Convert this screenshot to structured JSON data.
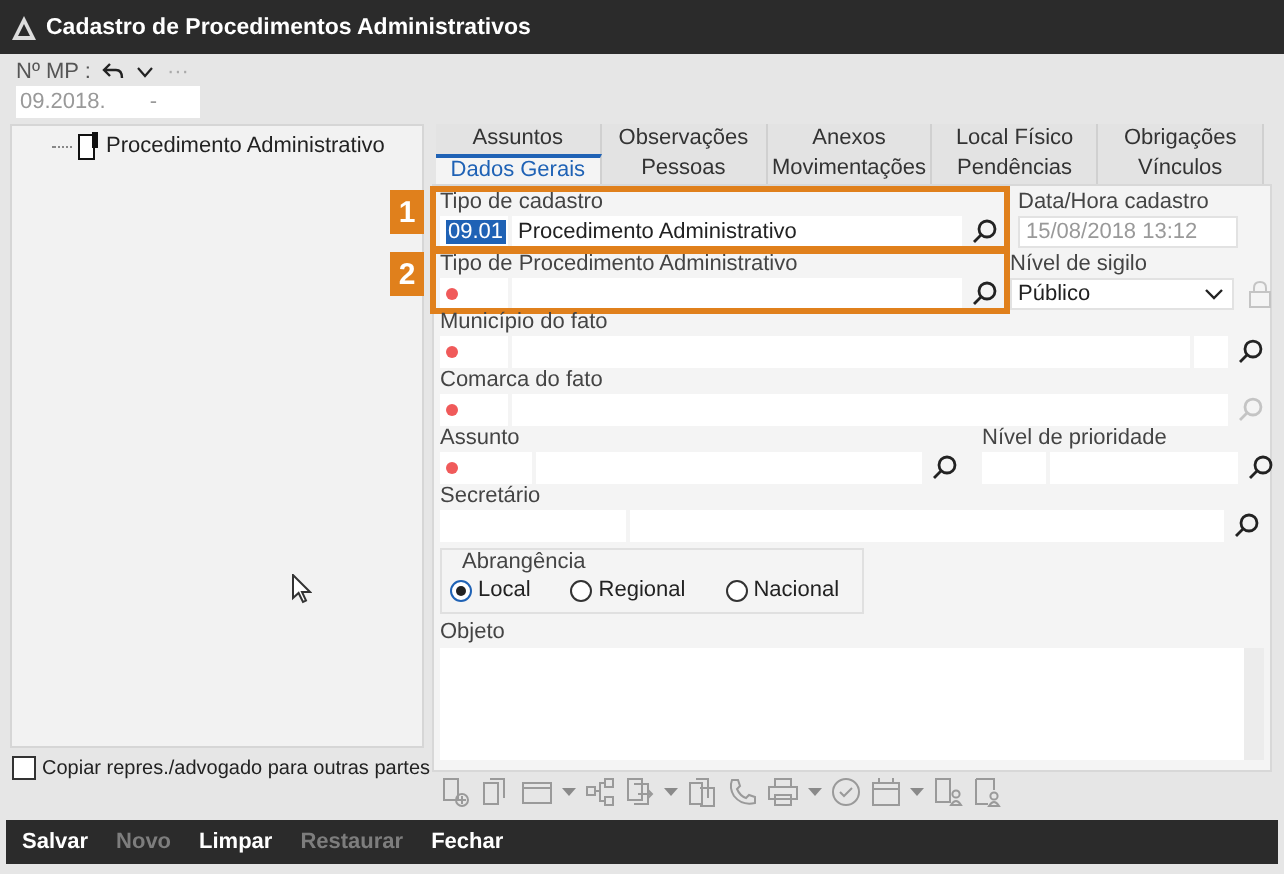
{
  "window": {
    "title": "Cadastro de Procedimentos Administrativos"
  },
  "mp": {
    "label": "Nº MP :",
    "value_parts": [
      "09.2018.",
      "-"
    ],
    "more": "···"
  },
  "tree": {
    "items": [
      {
        "label": "Procedimento Administrativo"
      }
    ]
  },
  "copy_checkbox": {
    "label": "Copiar repres./advogado para outras partes",
    "checked": false
  },
  "tab_rows": [
    [
      {
        "label": "Assuntos",
        "selected": false
      },
      {
        "label": "Observações",
        "selected": false
      },
      {
        "label": "Anexos",
        "selected": false
      },
      {
        "label": "Local Físico",
        "selected": false
      },
      {
        "label": "Obrigações",
        "selected": false
      }
    ],
    [
      {
        "label": "Dados Gerais",
        "selected": true
      },
      {
        "label": "Pessoas",
        "selected": false
      },
      {
        "label": "Movimentações",
        "selected": false
      },
      {
        "label": "Pendências",
        "selected": false
      },
      {
        "label": "Vínculos",
        "selected": false
      }
    ]
  ],
  "form": {
    "tipo_cadastro": {
      "label": "Tipo de cadastro",
      "code": "09.01",
      "code_selected": true,
      "value": "Procedimento Administrativo",
      "callout": "1"
    },
    "data_hora": {
      "label": "Data/Hora cadastro",
      "value": "15/08/2018 13:12"
    },
    "tipo_procedimento": {
      "label": "Tipo de Procedimento Administrativo",
      "required": true,
      "callout": "2"
    },
    "nivel_sigilo": {
      "label": "Nível de sigilo",
      "value": "Público"
    },
    "municipio": {
      "label": "Município do fato",
      "required": true
    },
    "comarca": {
      "label": "Comarca do fato",
      "required": true,
      "search_disabled": true
    },
    "assunto": {
      "label": "Assunto",
      "required": true
    },
    "nivel_prioridade": {
      "label": "Nível de prioridade"
    },
    "secretario": {
      "label": "Secretário"
    },
    "abrangencia": {
      "label": "Abrangência",
      "options": [
        {
          "label": "Local",
          "selected": true
        },
        {
          "label": "Regional",
          "selected": false
        },
        {
          "label": "Nacional",
          "selected": false
        }
      ]
    },
    "objeto": {
      "label": "Objeto"
    }
  },
  "buttons": [
    {
      "label": "Salvar",
      "disabled": false
    },
    {
      "label": "Novo",
      "disabled": true
    },
    {
      "label": "Limpar",
      "disabled": false
    },
    {
      "label": "Restaurar",
      "disabled": true
    },
    {
      "label": "Fechar",
      "disabled": false
    }
  ]
}
